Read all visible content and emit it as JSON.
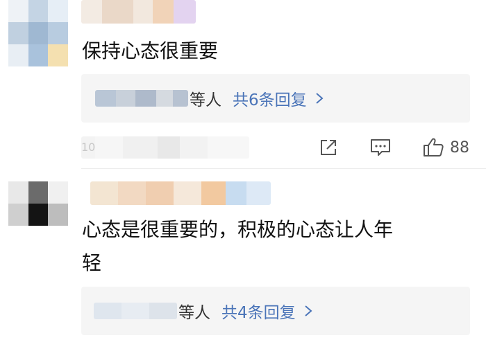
{
  "comments": [
    {
      "text": "保持心态很重要",
      "replies": {
        "who": "等人",
        "count": "共6条回复"
      },
      "footer": {
        "time_label": "10",
        "likes": "88"
      }
    },
    {
      "text_line1": "心态是很重要的，积极的心态让人年",
      "text_line2": "轻",
      "replies": {
        "who": "等人",
        "count": "共4条回复"
      }
    }
  ],
  "colors": {
    "accent": "#4a74b8",
    "reply_bg": "#f5f5f5"
  },
  "icons": [
    "share-icon",
    "comment-icon",
    "thumbs-up-icon",
    "chevron-right-icon"
  ]
}
